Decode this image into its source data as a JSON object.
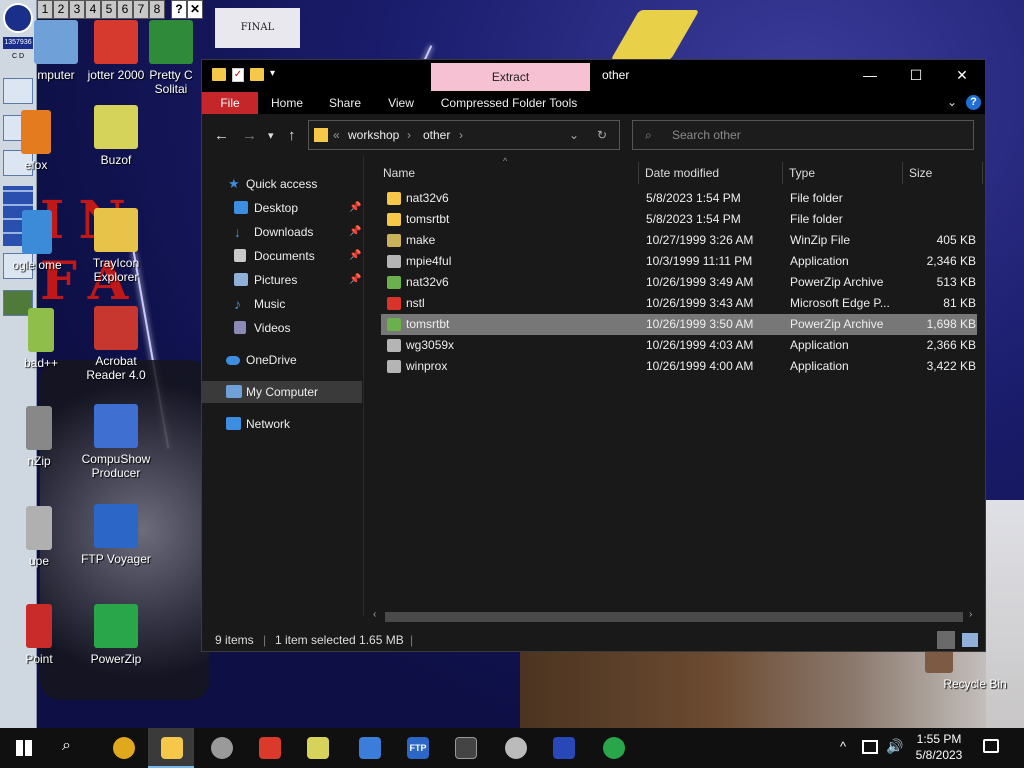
{
  "desktop": {
    "pager": [
      "1",
      "2",
      "3",
      "4",
      "5",
      "6",
      "7",
      "8",
      "?",
      "✕"
    ],
    "icons": [
      {
        "label": "mputer",
        "color": "#6fa0d8"
      },
      {
        "label": "jotter 2000",
        "color": "#d63a2e"
      },
      {
        "label": "Pretty C Solitai",
        "color": "#2f8a3a"
      },
      {
        "label": "efox",
        "color": "#e57b1f"
      },
      {
        "label": "Buzof",
        "color": "#d5d35a"
      },
      {
        "label": "ogle ome",
        "color": "#3c8bd8"
      },
      {
        "label": "TrayIcon Explorer",
        "color": "#e7c34a"
      },
      {
        "label": "bad++",
        "color": "#8fbf4a"
      },
      {
        "label": "Acrobat Reader 4.0",
        "color": "#c7372f"
      },
      {
        "label": "nZip",
        "color": "#888888"
      },
      {
        "label": "CompuShow Producer",
        "color": "#3e6fd1"
      },
      {
        "label": "upe",
        "color": "#b0b0b0"
      },
      {
        "label": "FTP Voyager",
        "color": "#2c66c7"
      },
      {
        "label": "Point",
        "color": "#c92a2a"
      },
      {
        "label": "PowerZip",
        "color": "#2aa64a"
      },
      {
        "label": "Recycle Bin",
        "color": "#7c5a44"
      }
    ],
    "wallpaper_banner": "FINAL FANTASY VII",
    "deco_text": "IN FA"
  },
  "window": {
    "title": "other",
    "extract_tab": "Extract",
    "controls": [
      "—",
      "☐",
      "✕"
    ],
    "ribbon_tabs": [
      "File",
      "Home",
      "Share",
      "View",
      "Compressed Folder Tools"
    ],
    "address": {
      "overflow": "«",
      "crumbs": [
        "workshop",
        "other"
      ]
    },
    "search_placeholder": "Search other",
    "nav": [
      {
        "label": "Quick access",
        "color": "#3d8ee0",
        "pinned": false
      },
      {
        "label": "Desktop",
        "color": "#3d8ee0",
        "pinned": true
      },
      {
        "label": "Downloads",
        "color": "#3d8ee0",
        "pinned": true
      },
      {
        "label": "Documents",
        "color": "#c9c9c9",
        "pinned": true
      },
      {
        "label": "Pictures",
        "color": "#8fb0d8",
        "pinned": true
      },
      {
        "label": "Music",
        "color": "#3d8ee0",
        "pinned": false
      },
      {
        "label": "Videos",
        "color": "#8a8ab8",
        "pinned": false
      },
      {
        "label": "OneDrive",
        "color": "#3d8ee0",
        "pinned": false
      },
      {
        "label": "My Computer",
        "color": "#6fa0d8",
        "pinned": false
      },
      {
        "label": "Network",
        "color": "#3d8ee0",
        "pinned": false
      }
    ],
    "columns": [
      "Name",
      "Date modified",
      "Type",
      "Size"
    ],
    "files": [
      {
        "name": "nat32v6",
        "date": "5/8/2023 1:54 PM",
        "type": "File folder",
        "size": "",
        "color": "#f5c84a",
        "selected": false
      },
      {
        "name": "tomsrtbt",
        "date": "5/8/2023 1:54 PM",
        "type": "File folder",
        "size": "",
        "color": "#f5c84a",
        "selected": false
      },
      {
        "name": "make",
        "date": "10/27/1999 3:26 AM",
        "type": "WinZip File",
        "size": "405 KB",
        "color": "#c9b25a",
        "selected": false
      },
      {
        "name": "mpie4ful",
        "date": "10/3/1999 11:11 PM",
        "type": "Application",
        "size": "2,346 KB",
        "color": "#b5b5b5",
        "selected": false
      },
      {
        "name": "nat32v6",
        "date": "10/26/1999 3:49 AM",
        "type": "PowerZip Archive",
        "size": "513 KB",
        "color": "#6ab04c",
        "selected": false
      },
      {
        "name": "nstl",
        "date": "10/26/1999 3:43 AM",
        "type": "Microsoft Edge P...",
        "size": "81 KB",
        "color": "#d9342b",
        "selected": false
      },
      {
        "name": "tomsrtbt",
        "date": "10/26/1999 3:50 AM",
        "type": "PowerZip Archive",
        "size": "1,698 KB",
        "color": "#6ab04c",
        "selected": true
      },
      {
        "name": "wg3059x",
        "date": "10/26/1999 4:03 AM",
        "type": "Application",
        "size": "2,366 KB",
        "color": "#b5b5b5",
        "selected": false
      },
      {
        "name": "winprox",
        "date": "10/26/1999 4:00 AM",
        "type": "Application",
        "size": "3,422 KB",
        "color": "#b5b5b5",
        "selected": false
      }
    ],
    "status": {
      "items": "9 items",
      "selection": "1 item selected  1.65 MB"
    }
  },
  "taskbar": {
    "apps": [
      {
        "name": "chrome",
        "color": "#e0a81c"
      },
      {
        "name": "file-explorer",
        "color": "#f5c84a"
      },
      {
        "name": "app-3",
        "color": "#9a9a9a"
      },
      {
        "name": "app-4",
        "color": "#d93a2b"
      },
      {
        "name": "buzof",
        "color": "#d5d35a"
      },
      {
        "name": "app-6",
        "color": "#3b7dd8"
      },
      {
        "name": "ftp",
        "color": "#2c66c7"
      },
      {
        "name": "terminal",
        "color": "#444444"
      },
      {
        "name": "app-9",
        "color": "#bbbbbb"
      },
      {
        "name": "app-10",
        "color": "#2848b8"
      },
      {
        "name": "recycle",
        "color": "#2aa64a"
      }
    ],
    "time": "1:55 PM",
    "date": "5/8/2023"
  }
}
